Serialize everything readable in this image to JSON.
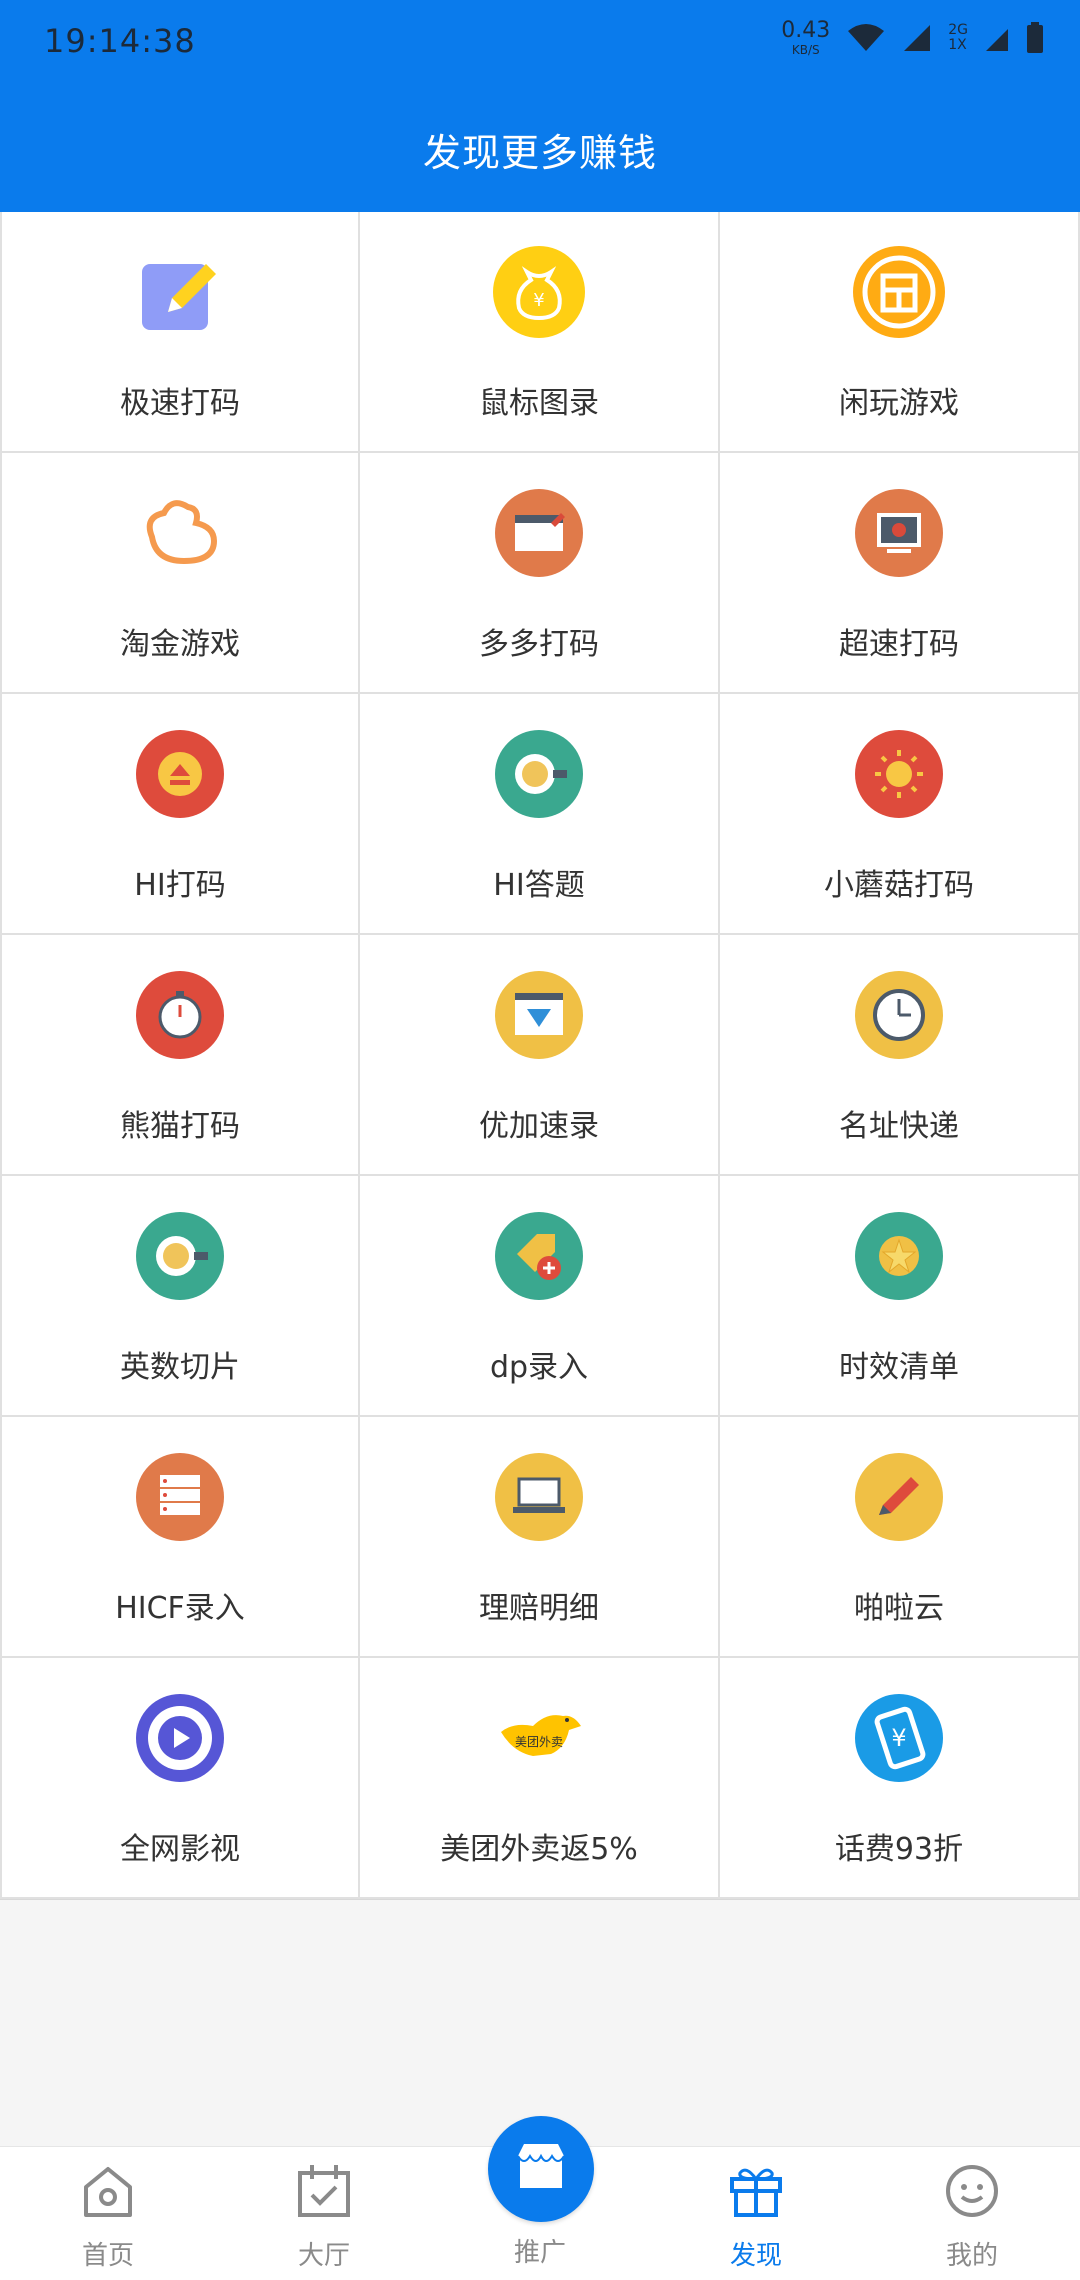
{
  "status_bar": {
    "time": "19:14:38",
    "net_speed": "0.43",
    "net_unit": "KB/S",
    "sim_type": "2G",
    "sim_slot": "1X"
  },
  "header": {
    "title": "发现更多赚钱"
  },
  "apps": [
    {
      "label": "极速打码",
      "icon": "notepad-pencil-icon"
    },
    {
      "label": "鼠标图录",
      "icon": "money-bag-icon"
    },
    {
      "label": "闲玩游戏",
      "icon": "xianwan-logo-icon"
    },
    {
      "label": "淘金游戏",
      "icon": "gold-ingot-icon"
    },
    {
      "label": "多多打码",
      "icon": "spreadsheet-edit-icon"
    },
    {
      "label": "超速打码",
      "icon": "video-monitor-icon"
    },
    {
      "label": "HI打码",
      "icon": "eject-icon"
    },
    {
      "label": "HI答题",
      "icon": "coffee-cup-icon"
    },
    {
      "label": "小蘑菇打码",
      "icon": "sun-icon"
    },
    {
      "label": "熊猫打码",
      "icon": "stopwatch-icon"
    },
    {
      "label": "优加速录",
      "icon": "diamond-browser-icon"
    },
    {
      "label": "名址快递",
      "icon": "clock-icon"
    },
    {
      "label": "英数切片",
      "icon": "coffee-cup-icon"
    },
    {
      "label": "dp录入",
      "icon": "tag-plus-icon"
    },
    {
      "label": "时效清单",
      "icon": "star-badge-icon"
    },
    {
      "label": "HICF录入",
      "icon": "server-rack-icon"
    },
    {
      "label": "理赔明细",
      "icon": "laptop-icon"
    },
    {
      "label": "啪啦云",
      "icon": "pencil-icon"
    },
    {
      "label": "全网影视",
      "icon": "play-button-icon"
    },
    {
      "label": "美团外卖返5%",
      "icon": "meituan-kangaroo-icon"
    },
    {
      "label": "话费93折",
      "icon": "phone-yuan-icon"
    }
  ],
  "meituan_logo_text": "美团外卖",
  "bottom_nav": {
    "items": [
      {
        "label": "首页",
        "icon": "home-icon"
      },
      {
        "label": "大厅",
        "icon": "calendar-check-icon"
      },
      {
        "label": "推广",
        "icon": "store-icon"
      },
      {
        "label": "发现",
        "icon": "gift-icon"
      },
      {
        "label": "我的",
        "icon": "smiley-icon"
      }
    ],
    "active": "发现"
  },
  "colors": {
    "brand_blue": "#0a7bec",
    "inactive_text": "#8a8a8a"
  }
}
